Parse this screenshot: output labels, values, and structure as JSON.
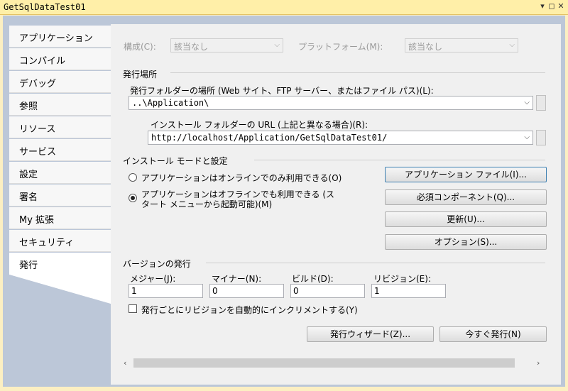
{
  "window": {
    "title": "GetSqlDataTest01"
  },
  "sidebar": {
    "items": [
      {
        "label": "アプリケーション"
      },
      {
        "label": "コンパイル"
      },
      {
        "label": "デバッグ"
      },
      {
        "label": "参照"
      },
      {
        "label": "リソース"
      },
      {
        "label": "サービス"
      },
      {
        "label": "設定"
      },
      {
        "label": "署名"
      },
      {
        "label": "My 拡張"
      },
      {
        "label": "セキュリティ"
      },
      {
        "label": "発行"
      }
    ],
    "active_index": 10
  },
  "config": {
    "config_label": "構成(C):",
    "config_value": "該当なし",
    "platform_label": "プラットフォーム(M):",
    "platform_value": "該当なし"
  },
  "publish_location": {
    "section_title": "発行場所",
    "folder_label": "発行フォルダーの場所 (Web サイト、FTP サーバー、またはファイル パス)(L):",
    "folder_value": "..\\Application\\",
    "install_label": "インストール フォルダーの URL (上記と異なる場合)(R):",
    "install_value": "http://localhost/Application/GetSqlDataTest01/"
  },
  "install_mode": {
    "section_title": "インストール モードと設定",
    "online_label": "アプリケーションはオンラインでのみ利用できる(O)",
    "offline_label_1": "アプリケーションはオフラインでも利用できる (ス",
    "offline_label_2": "タート メニューから起動可能)(M)",
    "selected": "offline",
    "buttons": {
      "app_files": "アプリケーション ファイル(I)...",
      "prereq": "必須コンポーネント(Q)...",
      "updates": "更新(U)...",
      "options": "オプション(S)..."
    }
  },
  "version": {
    "section_title": "バージョンの発行",
    "major_label": "メジャー(J):",
    "major": "1",
    "minor_label": "マイナー(N):",
    "minor": "0",
    "build_label": "ビルド(D):",
    "build": "0",
    "revision_label": "リビジョン(E):",
    "revision": "1",
    "auto_increment_label": "発行ごとにリビジョンを自動的にインクリメントする(Y)",
    "auto_increment_checked": false
  },
  "footer": {
    "wizard_button": "発行ウィザード(Z)...",
    "publish_now_button": "今すぐ発行(N)"
  }
}
